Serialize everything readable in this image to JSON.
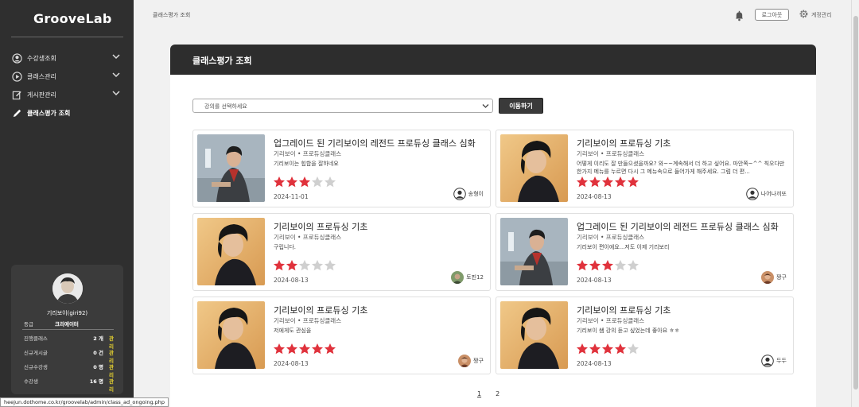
{
  "brand": {
    "logo": "GrooveLab"
  },
  "sidebar": {
    "items": [
      {
        "label": "수강생조회",
        "icon": "user-circle-icon",
        "expandable": true
      },
      {
        "label": "클래스관리",
        "icon": "play-circle-icon",
        "expandable": true
      },
      {
        "label": "게시판관리",
        "icon": "edit-square-icon",
        "expandable": true
      },
      {
        "label": "클래스평가 조회",
        "icon": "pencil-icon",
        "expandable": false,
        "active": true
      }
    ],
    "profile": {
      "name": "기리보이(giri92)",
      "grade_label": "등급",
      "grade_value": "크리에이터",
      "stats": [
        {
          "label": "진행클래스",
          "value": "2 개",
          "action": "관리"
        },
        {
          "label": "신규게시글",
          "value": "0 건",
          "action": "관리"
        },
        {
          "label": "신규수강생",
          "value": "0 명",
          "action": "관리"
        },
        {
          "label": "수강생",
          "value": "16 명",
          "action": "관리"
        }
      ]
    }
  },
  "status_url": "heejun.dothome.co.kr/groovelab/admin/class_ad_ongoing.php",
  "topbar": {
    "breadcrumb": "클래스평가 조회",
    "logout_label": "로그아웃",
    "settings_label": "계정관리"
  },
  "page": {
    "title": "클래스평가 조회",
    "select_placeholder": "강의를 선택하세요",
    "move_button": "이동하기"
  },
  "reviews": [
    {
      "title": "업그레이드 된 기리보이의 레전드 프로듀싱 클래스 심화",
      "meta": "기리보이 • 프로듀싱클래스",
      "text": "기리보이는 힙합을 잘하네요",
      "rating": 3,
      "date": "2024-11-01",
      "user": "송형이",
      "thumb": "sitting",
      "avatar": "default"
    },
    {
      "title": "기리보이의 프로듀싱 기초",
      "meta": "기리보이 • 프로듀싱클래스",
      "text": "어떻게 이리도 잘 만들으셨을까요? 와~~계속해서 더 하고 싶어요. 마안쪽~^^ 칙오다만 한가지 메뉴를 누르면 다시 그 메뉴속으로 들어가게 해주세요. 그럼 더 편...",
      "rating": 5,
      "date": "2024-08-13",
      "user": "나어나끼또",
      "thumb": "portrait",
      "avatar": "default"
    },
    {
      "title": "기리보이의 프로듀싱 기초",
      "meta": "기리보이 • 프로듀싱클래스",
      "text": "구립니다.",
      "rating": 2,
      "date": "2024-08-13",
      "user": "토핀12",
      "thumb": "portrait",
      "avatar": "photo-green"
    },
    {
      "title": "업그레이드 된 기리보이의 레전드 프로듀싱 클래스 심화",
      "meta": "기리보이 • 프로듀싱클래스",
      "text": "기리보이 편이에요...저도 이제 기리보리",
      "rating": 3,
      "date": "2024-08-13",
      "user": "짱구",
      "thumb": "sitting",
      "avatar": "photo-warm"
    },
    {
      "title": "기리보이의 프로듀싱 기초",
      "meta": "기리보이 • 프로듀싱클래스",
      "text": "저에게도 관심을",
      "rating": 5,
      "date": "2024-08-13",
      "user": "짱구",
      "thumb": "portrait",
      "avatar": "photo-warm"
    },
    {
      "title": "기리보이의 프로듀싱 기초",
      "meta": "기리보이 • 프로듀싱클래스",
      "text": "기리보이 쌤 강의 듣고 싶었는데 좋아요 ㅎㅎ",
      "rating": 4,
      "date": "2024-08-13",
      "user": "두두",
      "thumb": "portrait",
      "avatar": "default"
    }
  ],
  "pagination": {
    "pages": [
      "1",
      "2"
    ],
    "current": "1"
  },
  "colors": {
    "sidebar": "#2f2f2f",
    "star_on": "#e0323c",
    "star_off": "#cfcfcf",
    "manage": "#e6d230"
  }
}
